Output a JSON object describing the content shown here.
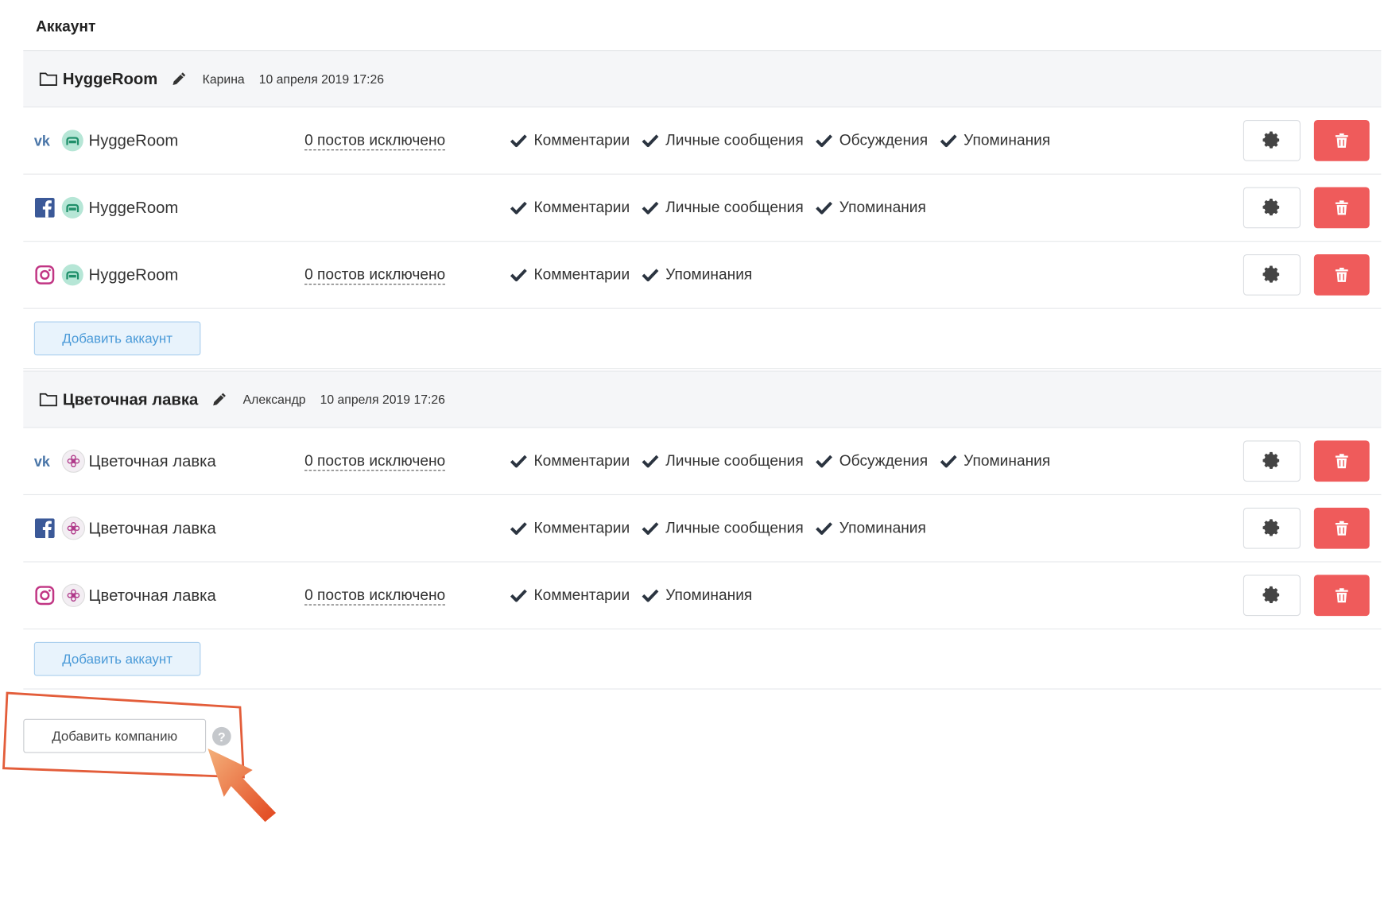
{
  "section_title": "Аккаунт",
  "companies": [
    {
      "name": "HyggeRoom",
      "owner": "Карина",
      "date": "10 апреля 2019 17:26",
      "add_account_label": "Добавить аккаунт",
      "accounts": [
        {
          "network": "vk",
          "name": "HyggeRoom",
          "excluded": "0 постов исключено",
          "features": [
            "Комментарии",
            "Личные сообщения",
            "Обсуждения",
            "Упоминания"
          ]
        },
        {
          "network": "facebook",
          "name": "HyggeRoom",
          "excluded": "",
          "features": [
            "Комментарии",
            "Личные сообщения",
            "Упоминания"
          ]
        },
        {
          "network": "instagram",
          "name": "HyggeRoom",
          "excluded": "0 постов исключено",
          "features": [
            "Комментарии",
            "Упоминания"
          ]
        }
      ]
    },
    {
      "name": "Цветочная лавка",
      "owner": "Александр",
      "date": "10 апреля 2019 17:26",
      "add_account_label": "Добавить аккаунт",
      "accounts": [
        {
          "network": "vk",
          "name": "Цветочная лавка",
          "excluded": "0 постов исключено",
          "features": [
            "Комментарии",
            "Личные сообщения",
            "Обсуждения",
            "Упоминания"
          ]
        },
        {
          "network": "facebook",
          "name": "Цветочная лавка",
          "excluded": "",
          "features": [
            "Комментарии",
            "Личные сообщения",
            "Упоминания"
          ]
        },
        {
          "network": "instagram",
          "name": "Цветочная лавка",
          "excluded": "0 постов исключено",
          "features": [
            "Комментарии",
            "Упоминания"
          ]
        }
      ]
    }
  ],
  "add_company_label": "Добавить компанию",
  "help_symbol": "?",
  "colors": {
    "delete_red": "#ef5b5b",
    "vk_blue": "#4a76a8",
    "facebook_blue": "#3b5998",
    "instagram_pink": "#c13584",
    "add_account_text": "#4a9ad8",
    "highlight_orange": "#e35d3a"
  },
  "icons": [
    "folder-icon",
    "pencil-icon",
    "vk-icon",
    "facebook-icon",
    "instagram-icon",
    "checkmark-icon",
    "gear-icon",
    "trash-icon",
    "question-icon",
    "pointer-arrow"
  ]
}
